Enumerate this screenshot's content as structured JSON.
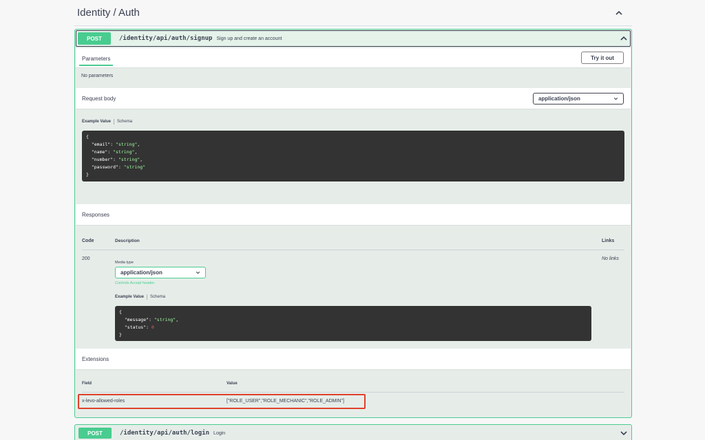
{
  "tag": {
    "title": "Identity / Auth"
  },
  "signup": {
    "method": "POST",
    "path": "/identity/api/auth/signup",
    "description": "Sign up and create an account",
    "parameters_tab": "Parameters",
    "try_it_out": "Try it out",
    "no_parameters": "No parameters",
    "request_body_label": "Request body",
    "request_content_type": "application/json",
    "example_value_tab": "Example Value",
    "schema_tab": "Schema",
    "request_example": {
      "open": "{",
      "lines": [
        {
          "key": "\"email\"",
          "value": "\"string\"",
          "trail": ","
        },
        {
          "key": "\"name\"",
          "value": "\"string\"",
          "trail": ","
        },
        {
          "key": "\"number\"",
          "value": "\"string\"",
          "trail": ","
        },
        {
          "key": "\"password\"",
          "value": "\"string\"",
          "trail": ""
        }
      ],
      "close": "}"
    },
    "responses_label": "Responses",
    "responses_table": {
      "col_code": "Code",
      "col_description": "Description",
      "col_links": "Links"
    },
    "response_200": {
      "code": "200",
      "media_type_label": "Media type",
      "media_type": "application/json",
      "controls_accept": "Controls Accept header.",
      "example_value_tab": "Example Value",
      "schema_tab": "Schema",
      "example": {
        "open": "{",
        "message_key": "\"message\"",
        "message_value": "\"string\"",
        "status_key": "\"status\"",
        "status_value": "0",
        "close": "}"
      },
      "links": "No links"
    },
    "extensions_label": "Extensions",
    "extensions_table": {
      "col_field": "Field",
      "col_value": "Value",
      "row_field": "x-levo-allowed-roles",
      "row_value": "[\"ROLE_USER\",\"ROLE_MECHANIC\",\"ROLE_ADMIN\"]"
    }
  },
  "login": {
    "method": "POST",
    "path": "/identity/api/auth/login",
    "description": "Login"
  },
  "colors": {
    "post_green": "#49cc90",
    "highlight_red": "#e0402a",
    "code_bg": "#333333"
  },
  "icons": {
    "collapse": "chevron-up-icon",
    "expand": "chevron-down-icon"
  }
}
